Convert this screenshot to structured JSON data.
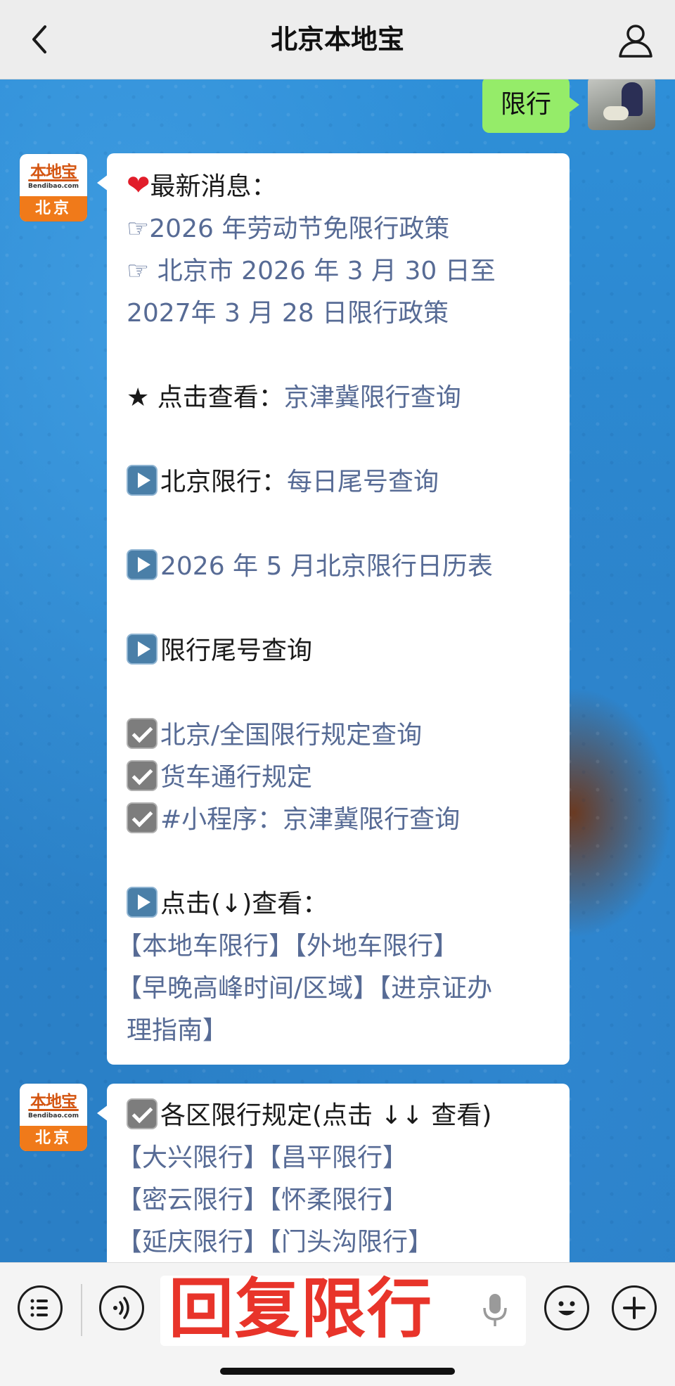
{
  "header": {
    "title": "北京本地宝",
    "back_icon": "chevron-left-icon",
    "profile_icon": "person-icon"
  },
  "outgoing": {
    "text": "限行"
  },
  "bot": {
    "logo_text": "本地宝",
    "logo_url": "Bendibao.com",
    "logo_city": "北京"
  },
  "message1": {
    "latest_label": "最新消息：",
    "line1": "☞2026 年劳动节免限行政策",
    "line2": "☞ 北京市 2026 年 3 月 30 日至",
    "line3": "2027年 3 月 28 日限行政策",
    "star_prefix": "★ 点击查看：",
    "star_link": "京津冀限行查询",
    "bj_prefix": "北京限行：",
    "bj_link": "每日尾号查询",
    "calendar_link": "2026 年 5 月北京限行日历表",
    "tail_query": "限行尾号查询",
    "check1": "北京/全国限行规定查询",
    "check2": "货车通行规定",
    "check3_prefix": "#小程序：",
    "check3_link": "京津冀限行查询",
    "click_label": "点击(↓)查看：",
    "link_local": "【本地车限行】",
    "link_outside": "【外地车限行】",
    "link_peak": "【早晚高峰时间/区域】",
    "link_permit_a": "【进京证办",
    "link_permit_b": "理指南】"
  },
  "message2": {
    "district_label": "各区限行规定(点击 ↓↓ 查看)",
    "d1": "【大兴限行】",
    "d2": "【昌平限行】",
    "d3": "【密云限行】",
    "d4": "【怀柔限行】",
    "d5": "【延庆限行】",
    "d6": "【门头沟限行】"
  },
  "bottom": {
    "reply_overlay": "回复限行",
    "icons": [
      "menu-icon",
      "voice-icon",
      "mic-icon",
      "emoji-icon",
      "plus-icon"
    ]
  },
  "colors": {
    "link": "#576b95",
    "outgoing_bubble": "#95ec69",
    "overlay_red": "#e8342a",
    "logo_orange": "#f07a1a"
  }
}
